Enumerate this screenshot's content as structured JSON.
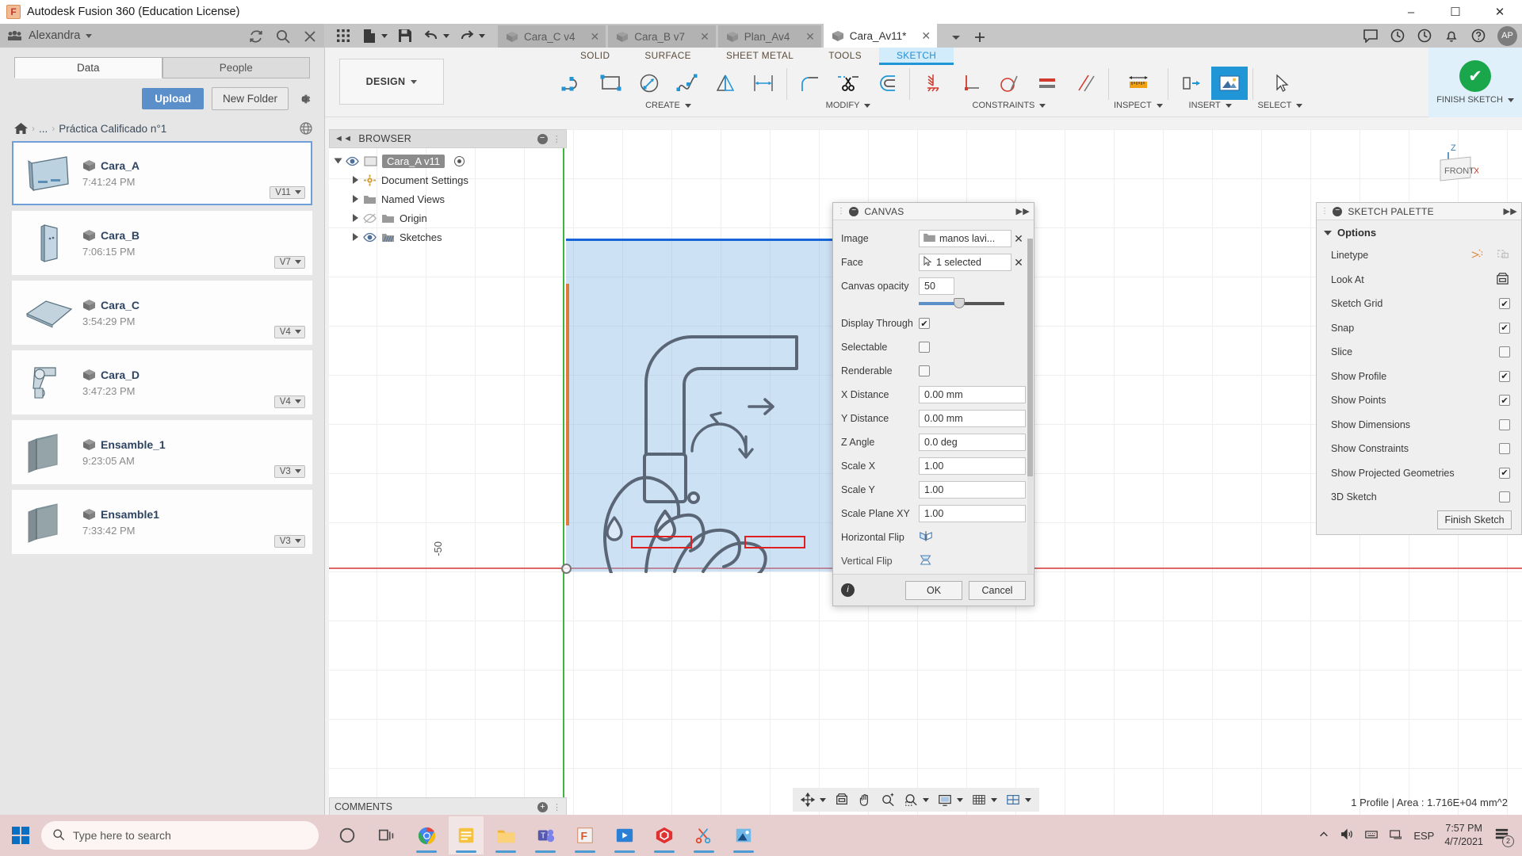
{
  "window": {
    "title": "Autodesk Fusion 360 (Education License)",
    "minimize": "–",
    "maximize": "☐",
    "close": "✕"
  },
  "data_panel": {
    "user": "Alexandra",
    "tabs": [
      {
        "label": "Data",
        "active": true
      },
      {
        "label": "People",
        "active": false
      }
    ],
    "upload_label": "Upload",
    "new_folder_label": "New Folder",
    "breadcrumb": {
      "home": "home-icon",
      "ellipsis": "...",
      "folder": "Práctica Calificado n°1"
    },
    "files": [
      {
        "name": "Cara_A",
        "time": "7:41:24 PM",
        "version": "V11",
        "selected": true
      },
      {
        "name": "Cara_B",
        "time": "7:06:15 PM",
        "version": "V7",
        "selected": false
      },
      {
        "name": "Cara_C",
        "time": "3:54:29 PM",
        "version": "V4",
        "selected": false
      },
      {
        "name": "Cara_D",
        "time": "3:47:23 PM",
        "version": "V4",
        "selected": false
      },
      {
        "name": "Ensamble_1",
        "time": "9:23:05 AM",
        "version": "V3",
        "selected": false
      },
      {
        "name": "Ensamble1",
        "time": "7:33:42 PM",
        "version": "V3",
        "selected": false
      }
    ]
  },
  "doc_tabs": [
    {
      "label": "Cara_C v4",
      "active": false
    },
    {
      "label": "Cara_B v7",
      "active": false
    },
    {
      "label": "Plan_Av4",
      "active": false
    },
    {
      "label": "Cara_Av11*",
      "active": true
    }
  ],
  "quick_access": {
    "grid": "grid-icon",
    "new": "new-doc-icon",
    "save": "save-icon",
    "undo": "undo-icon",
    "redo": "redo-icon"
  },
  "account": {
    "initials": "AP"
  },
  "ribbon": {
    "workspace": "DESIGN",
    "tabs": [
      {
        "label": "SOLID",
        "active": false
      },
      {
        "label": "SURFACE",
        "active": false
      },
      {
        "label": "SHEET METAL",
        "active": false
      },
      {
        "label": "TOOLS",
        "active": false
      },
      {
        "label": "SKETCH",
        "active": true
      }
    ],
    "groups": [
      {
        "label": "CREATE",
        "dropdown": true,
        "items": [
          "line-icon",
          "rectangle-icon",
          "circle-icon",
          "spline-icon",
          "mirror-icon",
          "dimension-icon"
        ]
      },
      {
        "label": "MODIFY",
        "dropdown": true,
        "items": [
          "fillet-icon",
          "trim-icon",
          "offset-icon"
        ]
      },
      {
        "label": "CONSTRAINTS",
        "dropdown": true,
        "items": [
          "fix-constraint-icon",
          "perpendicular-icon",
          "tangent-icon",
          "equal-icon",
          "parallel-icon"
        ]
      },
      {
        "label": "INSPECT",
        "dropdown": true,
        "items": [
          "measure-icon"
        ]
      },
      {
        "label": "INSERT",
        "dropdown": true,
        "items": [
          "insert-derive-icon",
          "canvas-icon"
        ]
      },
      {
        "label": "SELECT",
        "dropdown": true,
        "items": [
          "select-cursor-icon"
        ]
      },
      {
        "label": "FINISH SKETCH",
        "dropdown": true,
        "items": [
          "finish-check-icon"
        ]
      }
    ]
  },
  "browser": {
    "title": "BROWSER",
    "nodes": [
      {
        "label": "Cara_A v11",
        "selected": true,
        "indent": 0
      },
      {
        "label": "Document Settings",
        "selected": false,
        "indent": 1
      },
      {
        "label": "Named Views",
        "selected": false,
        "indent": 1
      },
      {
        "label": "Origin",
        "selected": false,
        "indent": 1
      },
      {
        "label": "Sketches",
        "selected": false,
        "indent": 1
      }
    ]
  },
  "viewport": {
    "dimension_label": "-50",
    "view_cube": {
      "face": "FRONT",
      "axis_z": "Z",
      "axis_x": "X"
    },
    "comments": "COMMENTS",
    "status": "1 Profile | Area : 1.716E+04 mm^2"
  },
  "canvas_dialog": {
    "title": "CANVAS",
    "rows": [
      {
        "label": "Image",
        "type": "picker",
        "value": "manos lavi...",
        "icon": "folder-icon"
      },
      {
        "label": "Face",
        "type": "picker",
        "value": "1 selected",
        "icon": "cursor-icon"
      },
      {
        "label": "Canvas opacity",
        "type": "input",
        "value": "50"
      },
      {
        "label": "Display Through",
        "type": "checkbox",
        "checked": true
      },
      {
        "label": "Selectable",
        "type": "checkbox",
        "checked": false
      },
      {
        "label": "Renderable",
        "type": "checkbox",
        "checked": false
      },
      {
        "label": "X Distance",
        "type": "input",
        "value": "0.00 mm"
      },
      {
        "label": "Y Distance",
        "type": "input",
        "value": "0.00 mm"
      },
      {
        "label": "Z Angle",
        "type": "input",
        "value": "0.0 deg"
      },
      {
        "label": "Scale X",
        "type": "input",
        "value": "1.00"
      },
      {
        "label": "Scale Y",
        "type": "input",
        "value": "1.00"
      },
      {
        "label": "Scale Plane XY",
        "type": "input",
        "value": "1.00"
      },
      {
        "label": "Horizontal Flip",
        "type": "iconbtn",
        "icon": "horizontal-flip-icon"
      },
      {
        "label": "Vertical Flip",
        "type": "iconbtn",
        "icon": "vertical-flip-icon"
      }
    ],
    "ok_label": "OK",
    "cancel_label": "Cancel"
  },
  "sketch_palette": {
    "title": "SKETCH PALETTE",
    "section": "Options",
    "rows": [
      {
        "label": "Linetype",
        "type": "icons"
      },
      {
        "label": "Look At",
        "type": "icon"
      },
      {
        "label": "Sketch Grid",
        "type": "checkbox",
        "checked": true
      },
      {
        "label": "Snap",
        "type": "checkbox",
        "checked": true
      },
      {
        "label": "Slice",
        "type": "checkbox",
        "checked": false
      },
      {
        "label": "Show Profile",
        "type": "checkbox",
        "checked": true
      },
      {
        "label": "Show Points",
        "type": "checkbox",
        "checked": true
      },
      {
        "label": "Show Dimensions",
        "type": "checkbox",
        "checked": false
      },
      {
        "label": "Show Constraints",
        "type": "checkbox",
        "checked": false
      },
      {
        "label": "Show Projected Geometries",
        "type": "checkbox",
        "checked": true
      },
      {
        "label": "3D Sketch",
        "type": "checkbox",
        "checked": false
      }
    ],
    "finish_label": "Finish Sketch"
  },
  "taskbar": {
    "search_placeholder": "Type here to search",
    "language": "ESP",
    "time": "7:57 PM",
    "date": "4/7/2021",
    "notification_count": "2"
  },
  "colors": {
    "accent_blue": "#2196d6",
    "upload_blue": "#5b8fc9",
    "finish_green": "#1aa64b",
    "sketch_face": "#89b8e6",
    "taskbar": "#e8cfcf"
  }
}
